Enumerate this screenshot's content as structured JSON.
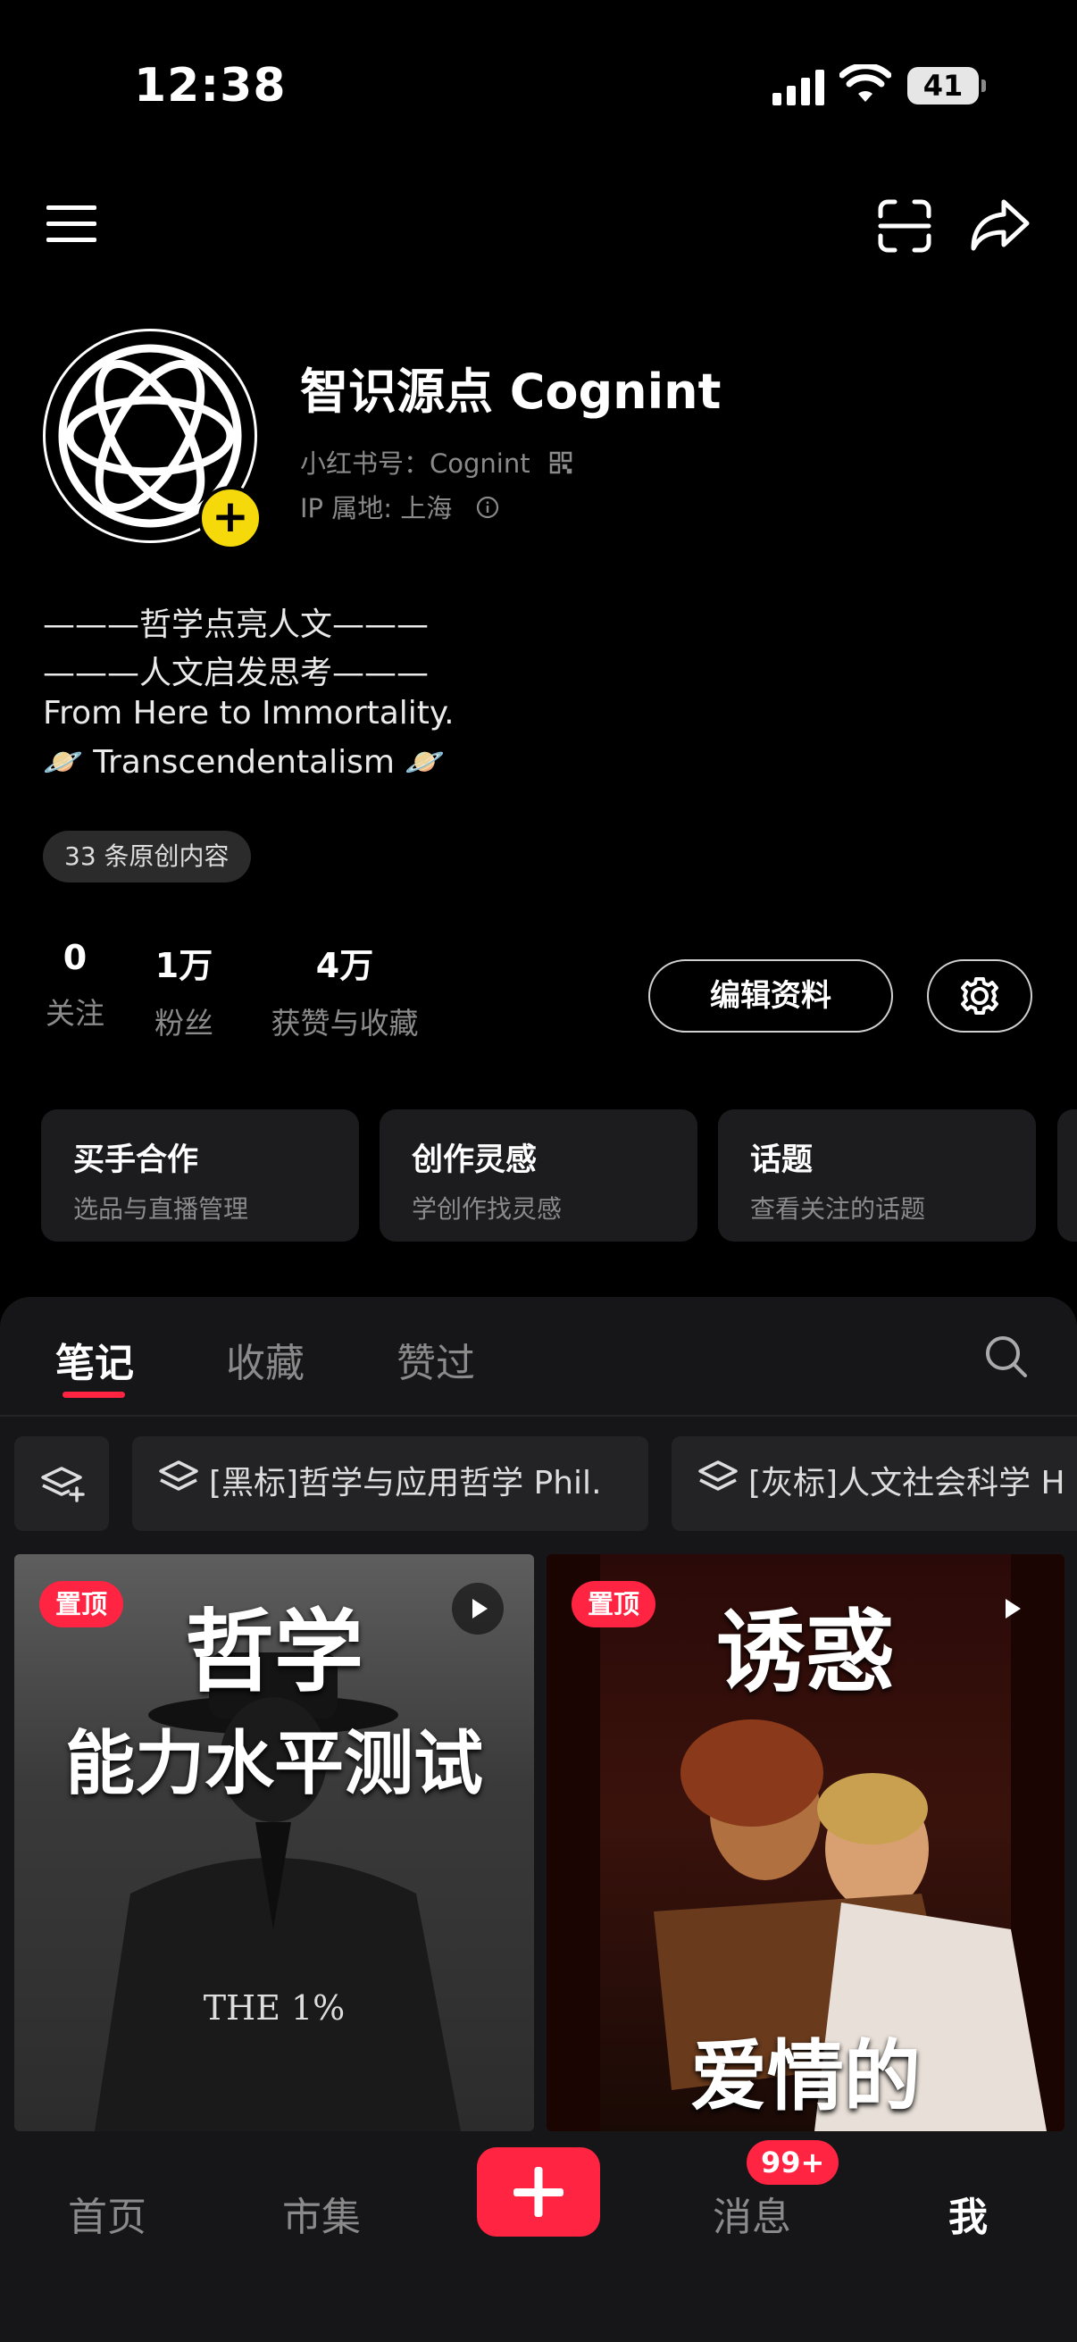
{
  "status_bar": {
    "time": "12:38",
    "battery": "41"
  },
  "profile": {
    "name": "智识源点 Cognint",
    "red_id": "小红书号：Cognint",
    "ip_location": "IP 属地: 上海",
    "bio": [
      "———哲学点亮人文———",
      "———人文启发思考———",
      "From Here to Immortality.",
      "🪐 Transcendentalism 🪐"
    ],
    "original_count_tag": "33 条原创内容",
    "stats": [
      {
        "value": "0",
        "label": "关注"
      },
      {
        "value": "1万",
        "label": "粉丝"
      },
      {
        "value": "4万",
        "label": "获赞与收藏"
      }
    ],
    "edit_button": "编辑资料"
  },
  "cards": [
    {
      "title": "买手合作",
      "subtitle": "选品与直播管理"
    },
    {
      "title": "创作灵感",
      "subtitle": "学创作找灵感"
    },
    {
      "title": "话题",
      "subtitle": "查看关注的话题"
    }
  ],
  "tabs": [
    "笔记",
    "收藏",
    "赞过"
  ],
  "collections": [
    "[黑标]哲学与应用哲学 Phil.",
    "[灰标]人文社会科学 H"
  ],
  "posts": [
    {
      "pin": "置顶",
      "title_line1": "哲学",
      "title_line2": "能力水平测试",
      "caption": "THE 1%"
    },
    {
      "pin": "置顶",
      "title_line1": "诱惑",
      "title_line2": "爱情的"
    }
  ],
  "bottom_nav": {
    "home": "首页",
    "market": "市集",
    "messages": "消息",
    "messages_badge": "99+",
    "me": "我"
  },
  "colors": {
    "accent": "#ff2442",
    "avatar_plus": "#f5d90a",
    "background": "#000000",
    "panel": "#161618"
  }
}
